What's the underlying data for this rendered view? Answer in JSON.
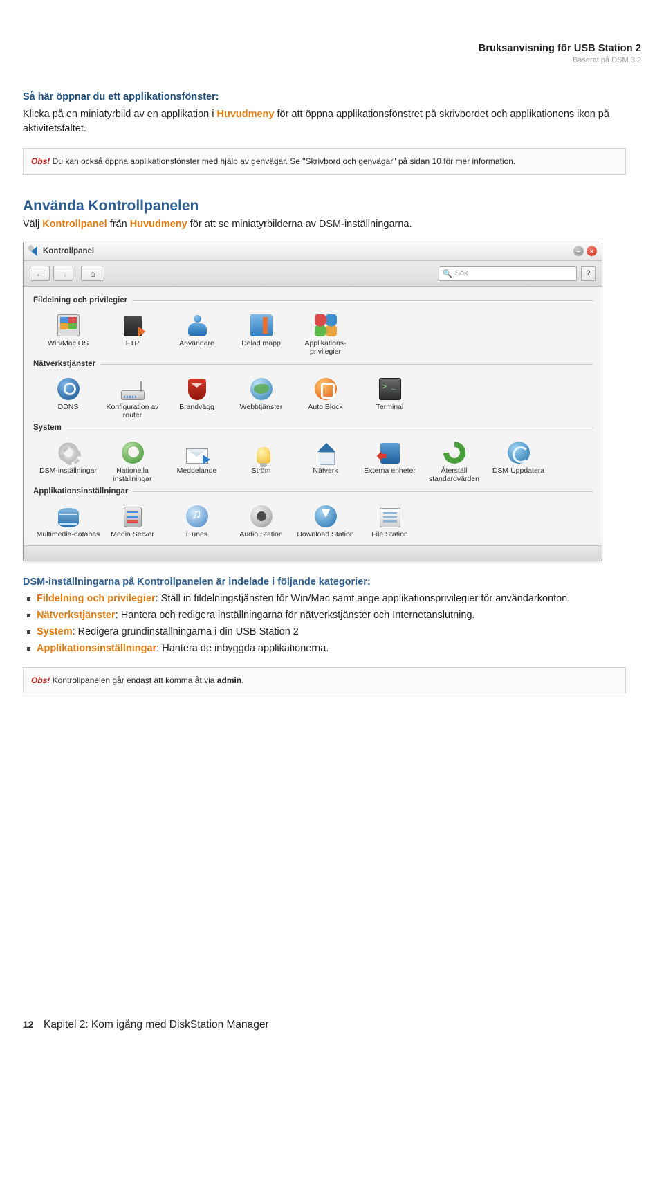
{
  "header": {
    "title": "Bruksanvisning för USB Station 2",
    "subtitle": "Baserat på DSM 3.2"
  },
  "intro": {
    "heading": "Så här öppnar du ett applikationsfönster:",
    "body_part1": "Klicka på en miniatyrbild av en applikation i ",
    "body_hl1": "Huvudmeny",
    "body_part2": " för att öppna applikationsfönstret på skrivbordet och applikationens ikon på aktivitetsfältet."
  },
  "note1": {
    "label": "Obs!",
    "text": " Du kan också öppna applikationsfönster med hjälp av genvägar. Se \"Skrivbord och genvägar\" på sidan 10 för mer information."
  },
  "section": {
    "heading": "Använda Kontrollpanelen",
    "lead_part1": "Välj ",
    "lead_hl1": "Kontrollpanel",
    "lead_part2": " från ",
    "lead_hl2": "Huvudmeny",
    "lead_part3": " för att se miniatyrbilderna av DSM-inställningarna."
  },
  "control_panel": {
    "window_title": "Kontrollpanel",
    "toolbar": {
      "back_label": "←",
      "forward_label": "→",
      "home_label": "⌂",
      "search_placeholder": "Sök",
      "help_label": "?"
    },
    "categories": [
      {
        "label": "Fildelning och privilegier",
        "items": [
          {
            "label": "Win/Mac OS",
            "icon": "monitor-icon"
          },
          {
            "label": "FTP",
            "icon": "server-icon"
          },
          {
            "label": "Användare",
            "icon": "person-icon"
          },
          {
            "label": "Delad mapp",
            "icon": "folder-icon"
          },
          {
            "label": "Applikations-privilegier",
            "icon": "cubes-icon"
          }
        ]
      },
      {
        "label": "Nätverkstjänster",
        "items": [
          {
            "label": "DDNS",
            "icon": "ddns-icon"
          },
          {
            "label": "Konfiguration av router",
            "icon": "router-icon"
          },
          {
            "label": "Brandvägg",
            "icon": "shield-icon"
          },
          {
            "label": "Webbtjänster",
            "icon": "globe-icon"
          },
          {
            "label": "Auto Block",
            "icon": "autoblock-icon"
          },
          {
            "label": "Terminal",
            "icon": "terminal-icon"
          }
        ]
      },
      {
        "label": "System",
        "items": [
          {
            "label": "DSM-inställningar",
            "icon": "gear-icon"
          },
          {
            "label": "Nationella inställningar",
            "icon": "clock-icon"
          },
          {
            "label": "Meddelande",
            "icon": "mail-icon"
          },
          {
            "label": "Ström",
            "icon": "bulb-icon"
          },
          {
            "label": "Nätverk",
            "icon": "network-icon"
          },
          {
            "label": "Externa enheter",
            "icon": "usb-icon"
          },
          {
            "label": "Återställ standardvärden",
            "icon": "restore-icon"
          },
          {
            "label": "DSM Uppdatera",
            "icon": "update-icon"
          }
        ]
      },
      {
        "label": "Applikationsinställningar",
        "items": [
          {
            "label": "Multimedia-databas",
            "icon": "multimedia-icon"
          },
          {
            "label": "Media Server",
            "icon": "mediaserver-icon"
          },
          {
            "label": "iTunes",
            "icon": "itunes-icon"
          },
          {
            "label": "Audio Station",
            "icon": "audio-icon"
          },
          {
            "label": "Download Station",
            "icon": "download-icon"
          },
          {
            "label": "File Station",
            "icon": "filestation-icon"
          }
        ]
      }
    ]
  },
  "post": {
    "heading": "DSM-inställningarna på Kontrollpanelen är indelade i följande kategorier:",
    "bullets": [
      {
        "term": "Fildelning och privilegier",
        "text": ": Ställ in fildelningstjänsten för Win/Mac samt ange applikationsprivilegier för användarkonton."
      },
      {
        "term": "Nätverkstjänster",
        "text": ": Hantera och redigera inställningarna för nätverkstjänster och Internetanslutning."
      },
      {
        "term": "System",
        "text": ": Redigera grundinställningarna i din USB Station 2"
      },
      {
        "term": "Applikationsinställningar",
        "text": ": Hantera de inbyggda applikationerna."
      }
    ]
  },
  "note2": {
    "label": "Obs!",
    "text_before": " Kontrollpanelen går endast att komma åt via ",
    "bold": "admin",
    "text_after": "."
  },
  "footer": {
    "page_number": "12",
    "text": "Kapitel 2: Kom igång med DiskStation Manager"
  },
  "colors": {
    "accent_orange": "#e07b10",
    "heading_blue": "#2e5f93",
    "note_red": "#c0211f"
  }
}
